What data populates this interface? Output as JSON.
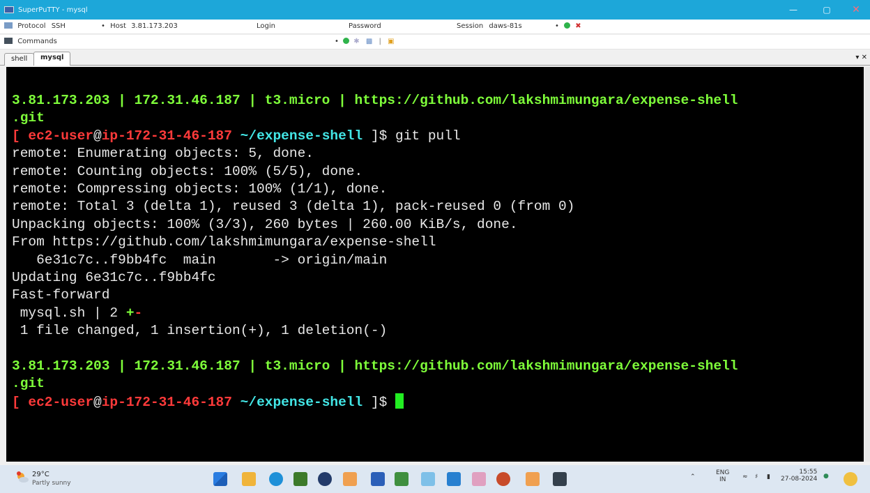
{
  "window": {
    "title": "SuperPuTTY - mysql"
  },
  "toolbar1": {
    "protocol_label": "Protocol",
    "protocol_value": "SSH",
    "host_label": "Host",
    "host_value": "3.81.173.203",
    "login_label": "Login",
    "password_label": "Password",
    "session_label": "Session",
    "session_value": "daws-81s"
  },
  "toolbar2": {
    "commands_label": "Commands"
  },
  "tabs": [
    {
      "label": "shell"
    },
    {
      "label": "mysql"
    }
  ],
  "terminal": {
    "lines": [
      {
        "segments": [
          {
            "text": "3.81.173.203 | 172.31.46.187 | t3.micro | https://github.com/lakshmimungara/expense-shell",
            "cls": "green"
          }
        ]
      },
      {
        "segments": [
          {
            "text": ".git",
            "cls": "green"
          }
        ]
      },
      {
        "segments": [
          {
            "text": "[ ",
            "cls": "red"
          },
          {
            "text": "ec2-user",
            "cls": "red"
          },
          {
            "text": "@",
            "cls": ""
          },
          {
            "text": "ip-172-31-46-187",
            "cls": "red"
          },
          {
            "text": " ~/expense-shell",
            "cls": "cyan"
          },
          {
            "text": " ]$ git pull",
            "cls": ""
          }
        ]
      },
      {
        "segments": [
          {
            "text": "remote: Enumerating objects: 5, done.",
            "cls": ""
          }
        ]
      },
      {
        "segments": [
          {
            "text": "remote: Counting objects: 100% (5/5), done.",
            "cls": ""
          }
        ]
      },
      {
        "segments": [
          {
            "text": "remote: Compressing objects: 100% (1/1), done.",
            "cls": ""
          }
        ]
      },
      {
        "segments": [
          {
            "text": "remote: Total 3 (delta 1), reused 3 (delta 1), pack-reused 0 (from 0)",
            "cls": ""
          }
        ]
      },
      {
        "segments": [
          {
            "text": "Unpacking objects: 100% (3/3), 260 bytes | 260.00 KiB/s, done.",
            "cls": ""
          }
        ]
      },
      {
        "segments": [
          {
            "text": "From https://github.com/lakshmimungara/expense-shell",
            "cls": ""
          }
        ]
      },
      {
        "segments": [
          {
            "text": "   6e31c7c..f9bb4fc  main       -> origin/main",
            "cls": ""
          }
        ]
      },
      {
        "segments": [
          {
            "text": "Updating 6e31c7c..f9bb4fc",
            "cls": ""
          }
        ]
      },
      {
        "segments": [
          {
            "text": "Fast-forward",
            "cls": ""
          }
        ]
      },
      {
        "segments": [
          {
            "text": " mysql.sh | 2 ",
            "cls": ""
          },
          {
            "text": "+",
            "cls": "green"
          },
          {
            "text": "-",
            "cls": "red"
          }
        ]
      },
      {
        "segments": [
          {
            "text": " 1 file changed, 1 insertion(+), 1 deletion(-)",
            "cls": ""
          }
        ]
      },
      {
        "segments": [
          {
            "text": "",
            "cls": ""
          }
        ]
      },
      {
        "segments": [
          {
            "text": "3.81.173.203 | 172.31.46.187 | t3.micro | https://github.com/lakshmimungara/expense-shell",
            "cls": "green"
          }
        ]
      },
      {
        "segments": [
          {
            "text": ".git",
            "cls": "green"
          }
        ]
      },
      {
        "segments": [
          {
            "text": "[ ",
            "cls": "red"
          },
          {
            "text": "ec2-user",
            "cls": "red"
          },
          {
            "text": "@",
            "cls": ""
          },
          {
            "text": "ip-172-31-46-187",
            "cls": "red"
          },
          {
            "text": " ~/expense-shell",
            "cls": "cyan"
          },
          {
            "text": " ]$ ",
            "cls": ""
          }
        ],
        "cursor": true
      }
    ]
  },
  "taskbar": {
    "weather_temp": "29°C",
    "weather_desc": "Partly sunny",
    "lang_top": "ENG",
    "lang_bottom": "IN",
    "time": "15:55",
    "date": "27-08-2024"
  },
  "colors": {
    "titlebar": "#1da7d9",
    "terminal_bg": "#000000",
    "prompt_green": "#7fff3a",
    "prompt_red": "#ff3a3a",
    "path_cyan": "#43e6e6",
    "cursor": "#22ee22"
  }
}
